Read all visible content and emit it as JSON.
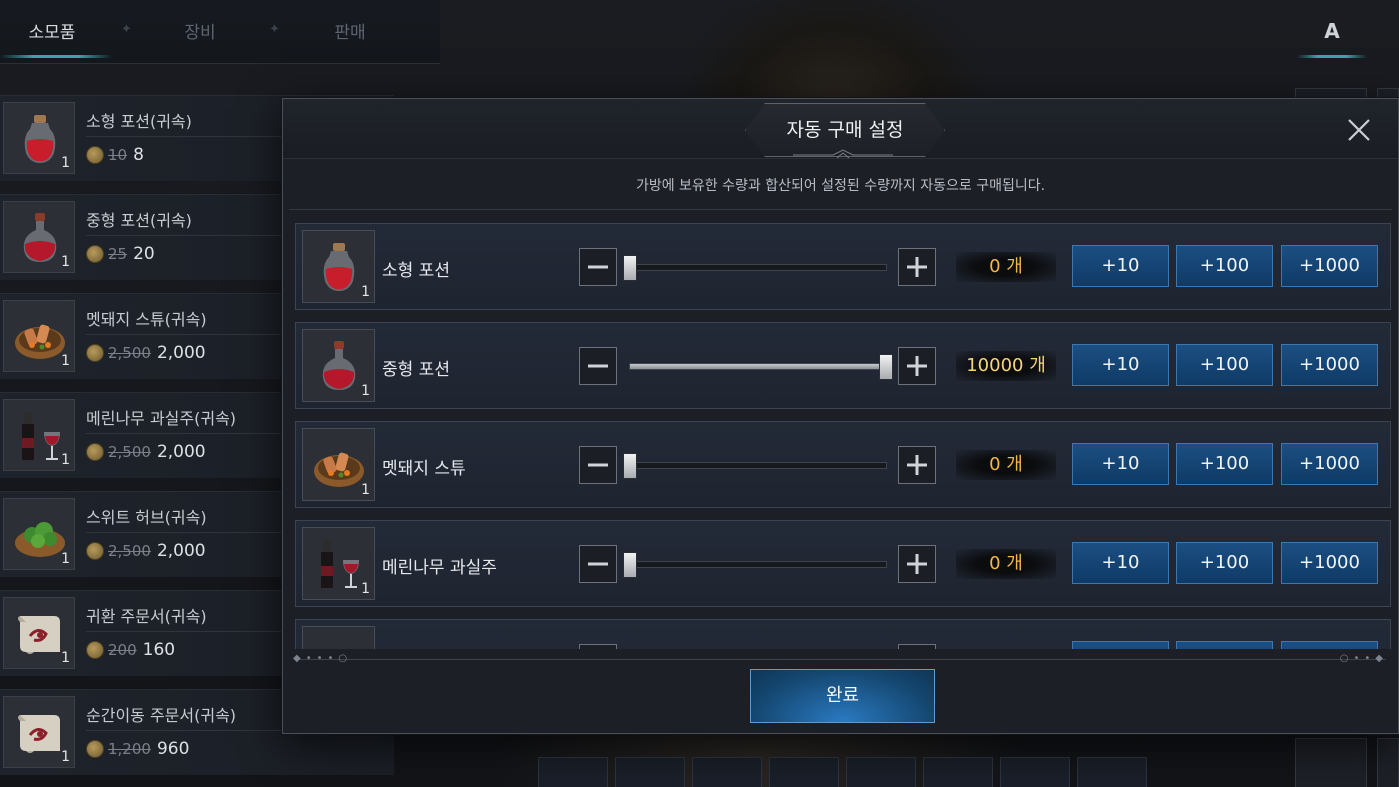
{
  "tabs": [
    {
      "label": "소모품",
      "active": true
    },
    {
      "label": "장비",
      "active": false
    },
    {
      "label": "판매",
      "active": false
    }
  ],
  "ai_badge": "A",
  "shop_items": [
    {
      "name": "소형 포션(귀속)",
      "count": "1",
      "old_price": "10",
      "price": "8",
      "icon": "small-potion-icon"
    },
    {
      "name": "중형 포션(귀속)",
      "count": "1",
      "old_price": "25",
      "price": "20",
      "icon": "medium-potion-icon"
    },
    {
      "name": "멧돼지 스튜(귀속)",
      "count": "1",
      "old_price": "2,500",
      "price": "2,000",
      "icon": "boar-stew-icon"
    },
    {
      "name": "메린나무 과실주(귀속)",
      "count": "1",
      "old_price": "2,500",
      "price": "2,000",
      "icon": "fruit-wine-icon"
    },
    {
      "name": "스위트 허브(귀속)",
      "count": "1",
      "old_price": "2,500",
      "price": "2,000",
      "icon": "sweet-herb-icon"
    },
    {
      "name": "귀환 주문서(귀속)",
      "count": "1",
      "old_price": "200",
      "price": "160",
      "icon": "return-scroll-icon"
    },
    {
      "name": "순간이동 주문서(귀속)",
      "count": "1",
      "old_price": "1,200",
      "price": "960",
      "icon": "teleport-scroll-icon"
    }
  ],
  "modal": {
    "title": "자동 구매 설정",
    "close_icon": "close-icon",
    "notice": "가방에 보유한 수량과 합산되어 설정된 수량까지 자동으로 구매됩니다.",
    "rows": [
      {
        "name": "소형 포션",
        "count": "1",
        "quantity": "0 개",
        "fill": 0.0,
        "icon": "small-potion-icon"
      },
      {
        "name": "중형 포션",
        "count": "1",
        "quantity": "10000 개",
        "fill": 1.0,
        "icon": "medium-potion-icon"
      },
      {
        "name": "멧돼지 스튜",
        "count": "1",
        "quantity": "0 개",
        "fill": 0.0,
        "icon": "boar-stew-icon"
      },
      {
        "name": "메린나무 과실주",
        "count": "1",
        "quantity": "0 개",
        "fill": 0.0,
        "icon": "fruit-wine-icon"
      }
    ],
    "add_buttons": [
      "+10",
      "+100",
      "+1000"
    ],
    "minus_label": "−",
    "plus_label": "+",
    "confirm": "완료"
  },
  "colors": {
    "accent_teal": "#3aa5a8",
    "button_blue": "#1b4f82",
    "quantity_gold": "#f0b74b"
  }
}
